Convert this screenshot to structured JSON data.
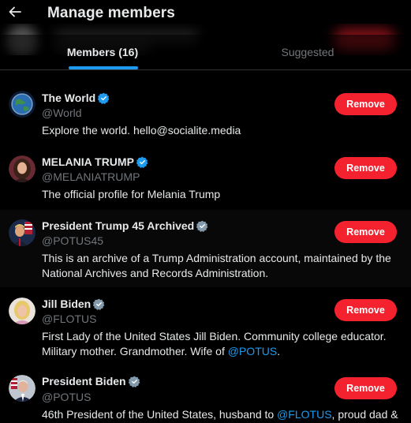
{
  "header": {
    "title": "Manage members",
    "back_icon": "arrow-left-icon"
  },
  "tabs": [
    {
      "label": "Members (16)",
      "active": true
    },
    {
      "label": "Suggested",
      "active": false
    }
  ],
  "colors": {
    "background": "#000000",
    "accent": "#1d9bf0",
    "remove_button": "#f4212e",
    "muted_text": "#71767b",
    "verified_blue": "#1d9bf0",
    "verified_gray": "#829aab"
  },
  "members": [
    {
      "name": "The World",
      "handle": "@World",
      "verified": "blue",
      "bio": "Explore the world. hello@socialite.media",
      "action": "Remove"
    },
    {
      "name": "MELANIA TRUMP",
      "handle": "@MELANIATRUMP",
      "verified": "blue",
      "bio": "The official profile for Melania Trump",
      "action": "Remove"
    },
    {
      "name": "President Trump 45 Archived",
      "handle": "@POTUS45",
      "verified": "gray",
      "bio": "This is an archive of a Trump Administration account, maintained by the National Archives and Records Administration.",
      "action": "Remove"
    },
    {
      "name": "Jill Biden",
      "handle": "@FLOTUS",
      "verified": "gray",
      "bio_parts": [
        "First Lady of the United States Jill Biden. Community college educator. Military mother. Grandmother. Wife of ",
        "@POTUS",
        "."
      ],
      "action": "Remove"
    },
    {
      "name": "President Biden",
      "handle": "@POTUS",
      "verified": "gray",
      "bio_parts": [
        "46th President of the United States, husband to ",
        "@FLOTUS",
        ", proud dad &"
      ],
      "action": "Remove"
    }
  ]
}
